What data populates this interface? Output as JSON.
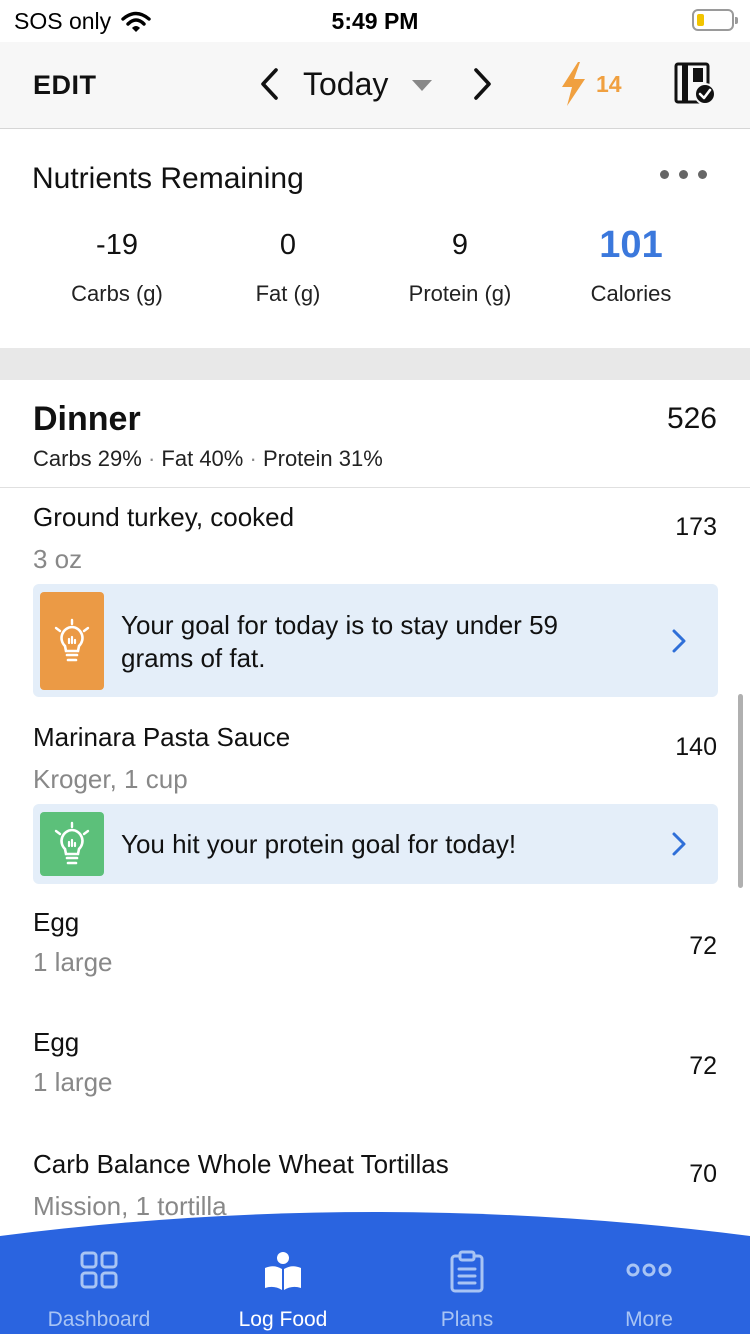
{
  "status_bar": {
    "carrier": "SOS only",
    "time": "5:49 PM",
    "battery_level": 0.2,
    "battery_color": "#f2c400"
  },
  "header": {
    "edit_label": "EDIT",
    "date_label": "Today",
    "streak_count": "14",
    "streak_color": "#f0a040",
    "icons": [
      "chevron-left-icon",
      "chevron-right-icon",
      "caret-down-icon",
      "lightning-icon",
      "plan-check-icon"
    ]
  },
  "nutrients": {
    "title": "Nutrients Remaining",
    "items": [
      {
        "value": "-19",
        "label": "Carbs (g)"
      },
      {
        "value": "0",
        "label": "Fat (g)"
      },
      {
        "value": "9",
        "label": "Protein (g)"
      },
      {
        "value": "101",
        "label": "Calories"
      }
    ],
    "highlight_color": "#3b78dc"
  },
  "meal": {
    "title": "Dinner",
    "total": "526",
    "carbs": "Carbs 29%",
    "fat": "Fat 40%",
    "protein": "Protein 31%",
    "separator": "·"
  },
  "foods": [
    {
      "name": "Ground turkey, cooked",
      "serving": "3 oz",
      "calories": "173"
    },
    {
      "name": "Marinara Pasta Sauce",
      "serving": "Kroger, 1 cup",
      "calories": "140"
    },
    {
      "name": "Egg",
      "serving": "1 large",
      "calories": "72"
    },
    {
      "name": "Egg",
      "serving": "1 large",
      "calories": "72"
    },
    {
      "name": "Carb Balance Whole Wheat Tortillas",
      "serving": "Mission, 1 tortilla",
      "calories": "70"
    }
  ],
  "tips": [
    {
      "line1": "Your goal for today is to stay under 59",
      "line2": "grams of fat.",
      "icon_color": "#eb9a45"
    },
    {
      "line1": "You hit your protein goal for today!",
      "icon_color": "#5cc07a"
    }
  ],
  "tabbar": {
    "background": "#2a64e0",
    "tabs": [
      {
        "label": "Dashboard",
        "icon": "dashboard-icon"
      },
      {
        "label": "Log Food",
        "icon": "log-food-icon",
        "active": true
      },
      {
        "label": "Plans",
        "icon": "clipboard-icon"
      },
      {
        "label": "More",
        "icon": "more-dots-icon"
      }
    ]
  }
}
